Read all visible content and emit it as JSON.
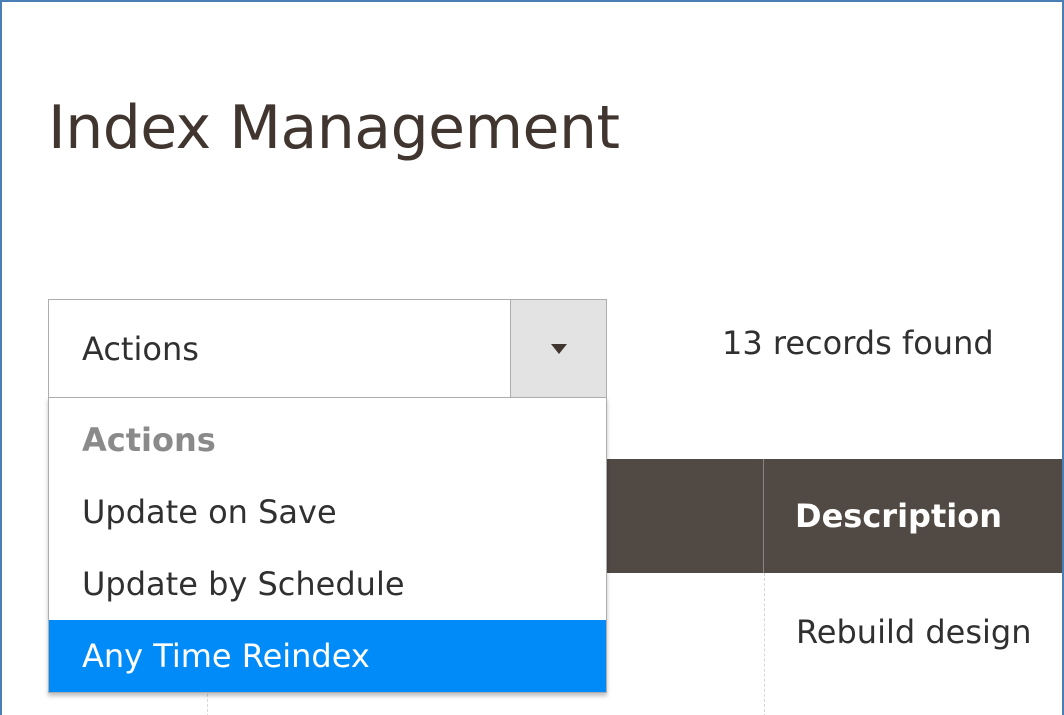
{
  "page": {
    "title": "Index Management"
  },
  "actions": {
    "selected_label": "Actions",
    "menu": {
      "header": "Actions",
      "options": [
        "Update on Save",
        "Update by Schedule",
        "Any Time Reindex"
      ],
      "highlighted": "Any Time Reindex"
    }
  },
  "grid": {
    "records_found": "13 records found",
    "columns": {
      "description": "Description"
    },
    "rows": [
      {
        "description": "Rebuild design"
      }
    ]
  },
  "colors": {
    "header_bg": "#514943",
    "highlight": "#008bf9",
    "title": "#41362f"
  }
}
